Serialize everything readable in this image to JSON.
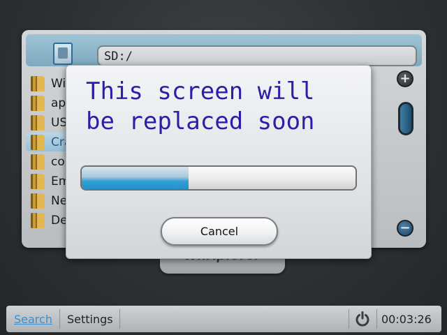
{
  "browser": {
    "path": "SD:/",
    "files": [
      {
        "label": "Wi"
      },
      {
        "label": "ap"
      },
      {
        "label": "US"
      },
      {
        "label": "Cra",
        "selected": true
      },
      {
        "label": "co"
      },
      {
        "label": "Em"
      },
      {
        "label": "Ne"
      },
      {
        "label": "De"
      }
    ],
    "scroll_up_symbol": "+",
    "scroll_down_symbol": "−",
    "logo_text": "WiiXplorer"
  },
  "dialog": {
    "message_line1": "This screen will",
    "message_line2": "be replaced soon",
    "progress_fraction": 0.39,
    "cancel_label": "Cancel"
  },
  "statusbar": {
    "search_label": "Search",
    "settings_label": "Settings",
    "clock": "00:03:26"
  },
  "colors": {
    "accent": "#2f9fd8",
    "message_text": "#2a1fa6",
    "search_link": "#3b8fcf"
  },
  "icons": {
    "sd_card": "sd-card-icon",
    "folder": "folder-icon",
    "power": "power-icon"
  }
}
